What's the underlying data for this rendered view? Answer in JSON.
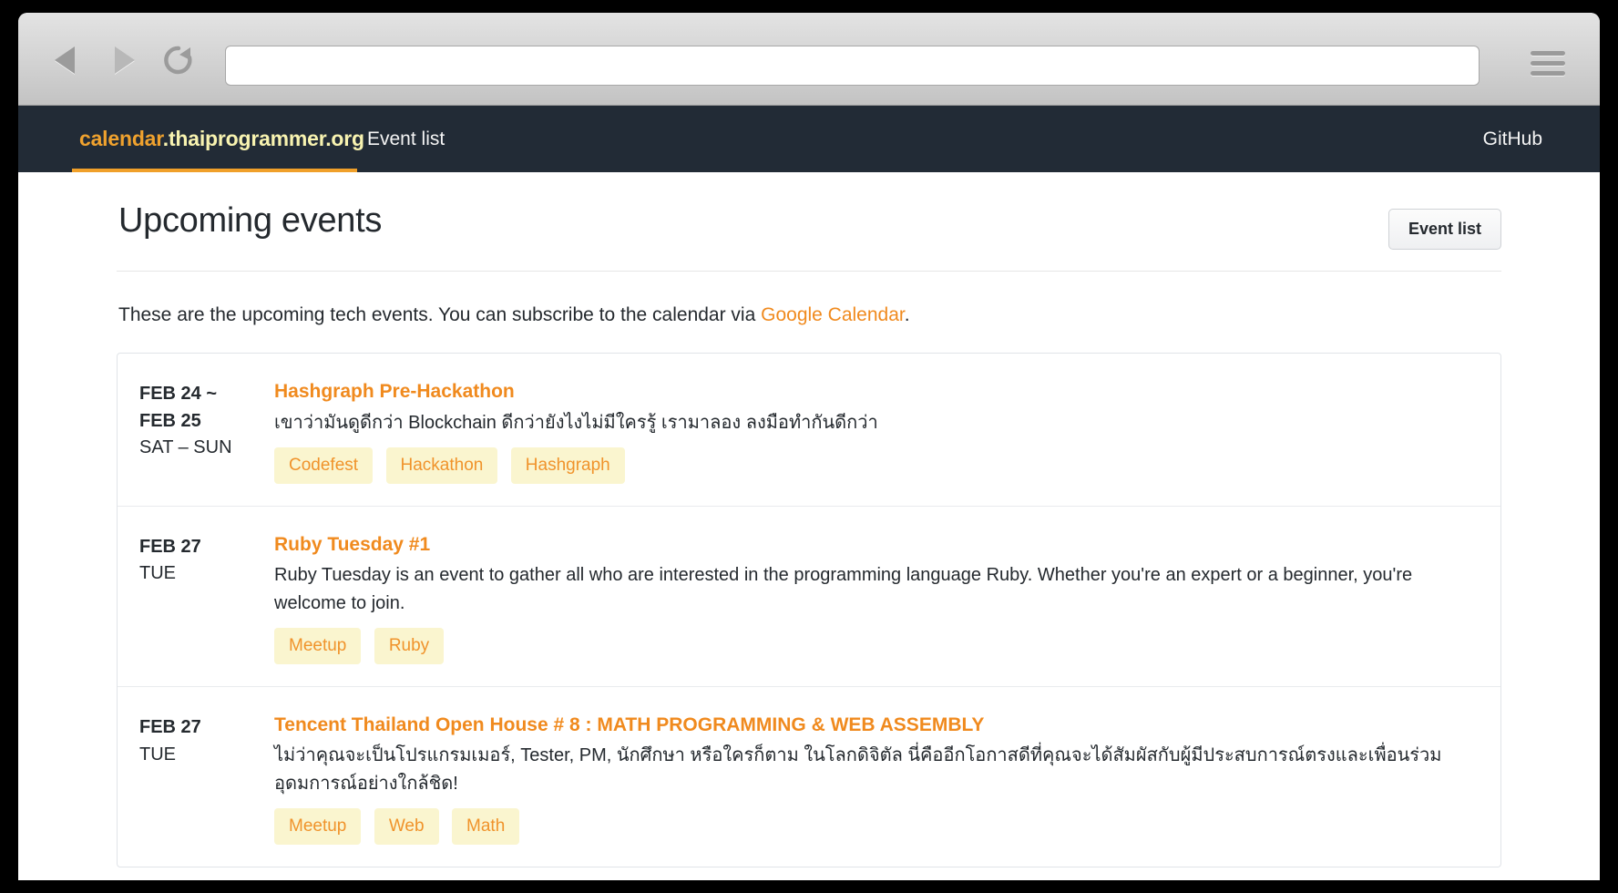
{
  "browser": {
    "back_icon": "back-arrow-icon",
    "forward_icon": "forward-arrow-icon",
    "reload_icon": "reload-icon",
    "menu_icon": "hamburger-menu-icon",
    "url_value": "",
    "url_placeholder": ""
  },
  "navbar": {
    "brand_primary": "calendar",
    "brand_secondary": ".thaiprogrammer.org",
    "event_list_label": "Event list",
    "github_label": "GitHub",
    "background": "#222b36",
    "accent": "#f0a02a"
  },
  "main": {
    "title": "Upcoming events",
    "header_button": "Event list",
    "intro_before": "These are the upcoming tech events. You can subscribe to the calendar via ",
    "intro_link": "Google Calendar",
    "intro_after": "."
  },
  "events": [
    {
      "date_line1": "FEB 24 ~",
      "date_line2": "FEB 25",
      "day": "SAT – SUN",
      "title": "Hashgraph Pre-Hackathon",
      "description": "เขาว่ามันดูดีกว่า Blockchain ดีกว่ายังไงไม่มีใครรู้ เรามาลอง ลงมือทำกันดีกว่า",
      "tags": [
        "Codefest",
        "Hackathon",
        "Hashgraph"
      ]
    },
    {
      "date_line1": "FEB 27",
      "date_line2": "",
      "day": "TUE",
      "title": "Ruby Tuesday #1",
      "description": "Ruby Tuesday is an event to gather all who are interested in the programming language Ruby. Whether you're an expert or a beginner, you're welcome to join.",
      "tags": [
        "Meetup",
        "Ruby"
      ]
    },
    {
      "date_line1": "FEB 27",
      "date_line2": "",
      "day": "TUE",
      "title": "Tencent Thailand Open House # 8 : MATH PROGRAMMING & WEB ASSEMBLY",
      "description": "ไม่ว่าคุณจะเป็นโปรแกรมเมอร์, Tester, PM, นักศึกษา หรือใครก็ตาม ในโลกดิจิตัล นี่คืออีกโอกาสดีที่คุณจะได้สัมผัสกับผู้มีประสบการณ์ตรงและเพื่อนร่วมอุดมการณ์อย่างใกล้ชิด!",
      "tags": [
        "Meetup",
        "Web",
        "Math"
      ]
    }
  ]
}
